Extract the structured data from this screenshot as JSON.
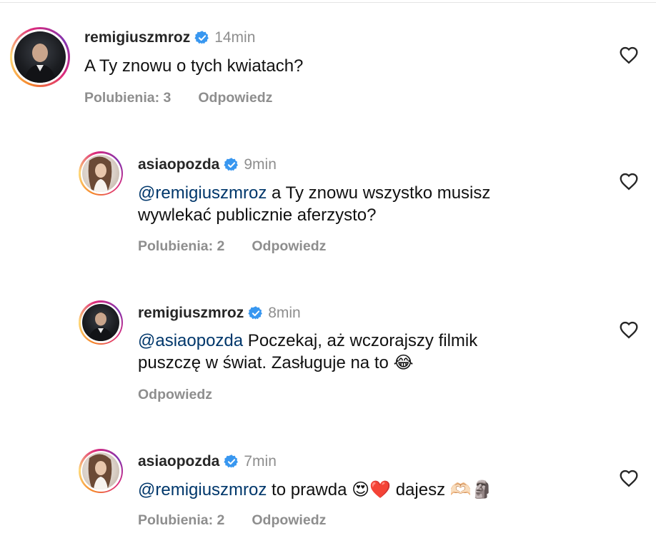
{
  "comments": [
    {
      "username": "remigiuszmroz",
      "time": "14min",
      "mention": "",
      "text": "A Ty znowu o tych kwiatach?",
      "likes_label": "Polubienia: 3",
      "reply_label": "Odpowiedz"
    },
    {
      "username": "asiaopozda",
      "time": "9min",
      "mention": "@remigiuszmroz",
      "text": " a Ty znowu wszystko musisz",
      "text2": "wywlekać publicznie aferzysto?",
      "likes_label": "Polubienia: 2",
      "reply_label": "Odpowiedz"
    },
    {
      "username": "remigiuszmroz",
      "time": "8min",
      "mention": "@asiaopozda",
      "text": " Poczekaj, aż wczorajszy filmik",
      "text2": "puszczę w świat. Zasługuje na to",
      "emoji": "😂",
      "reply_label": "Odpowiedz"
    },
    {
      "username": "asiaopozda",
      "time": "7min",
      "mention": "@remigiuszmroz",
      "text": " to prawda ",
      "emoji1": "😍❤️",
      "text_b": " dajesz ",
      "emoji2": "🫶🏻🗿",
      "likes_label": "Polubienia: 2",
      "reply_label": "Odpowiedz"
    }
  ],
  "icons": {
    "verified": "verified-badge-icon",
    "like": "heart-outline-icon"
  },
  "colors": {
    "verified": "#3897f0",
    "mention": "#00376b",
    "muted": "#8e8e8e"
  }
}
